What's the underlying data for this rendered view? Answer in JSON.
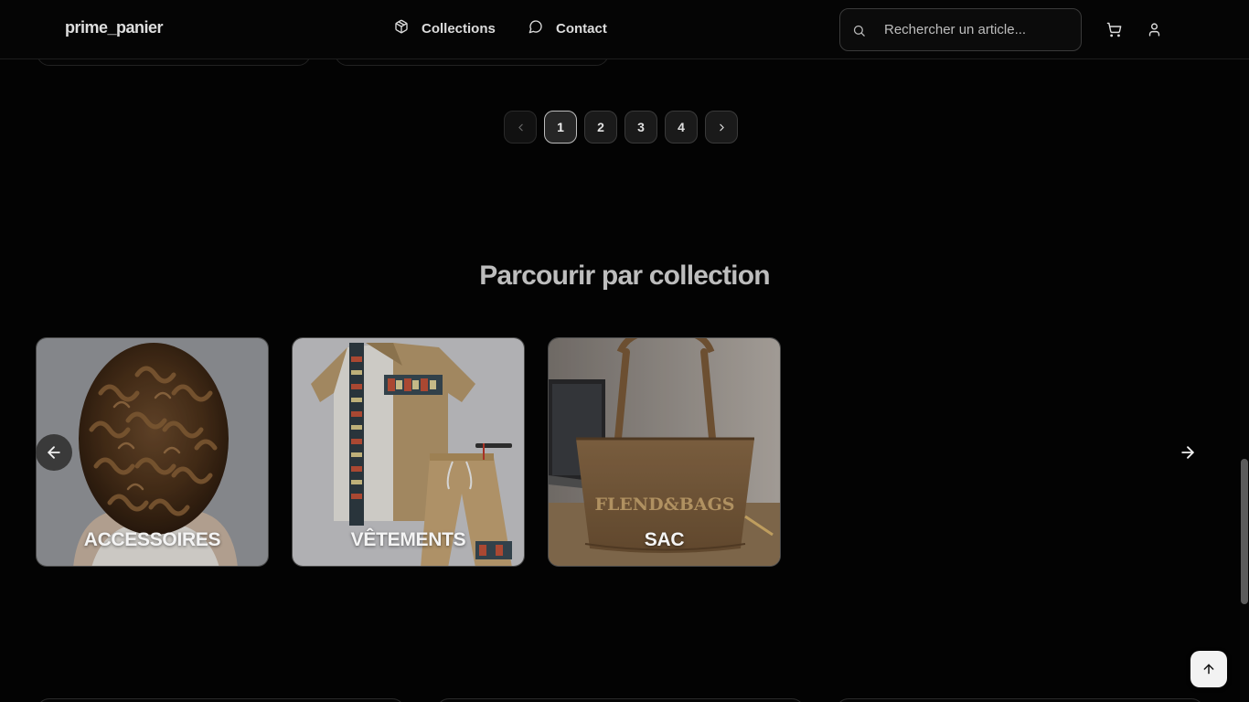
{
  "header": {
    "logo": "prime_panier",
    "nav": [
      {
        "label": "Collections",
        "icon": "box-icon"
      },
      {
        "label": "Contact",
        "icon": "message-circle-icon"
      }
    ],
    "search": {
      "placeholder": "Rechercher un article..."
    },
    "icons": [
      "cart-icon",
      "user-icon"
    ]
  },
  "pagination": {
    "pages": [
      "1",
      "2",
      "3",
      "4"
    ],
    "current": "1",
    "prev_enabled": false,
    "next_enabled": true
  },
  "collections": {
    "title": "Parcourir par collection",
    "items": [
      {
        "label": "ACCESSOIRES"
      },
      {
        "label": "VÊTEMENTS"
      },
      {
        "label": "SAC",
        "image_text": "FLEND&BAGS"
      }
    ]
  },
  "colors": {
    "background": "#030303",
    "text": "#e8e8e8",
    "heading": "#bdbdbd",
    "border": "#3a3a3a"
  }
}
